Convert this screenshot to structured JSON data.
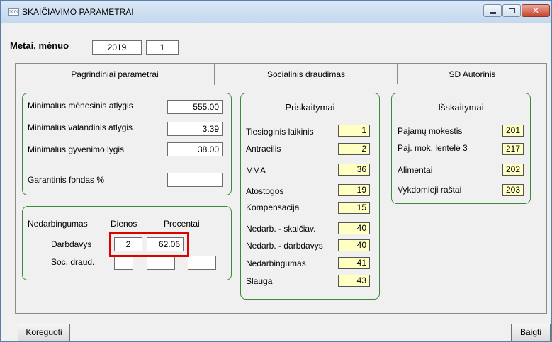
{
  "window": {
    "icon_text": "nono",
    "title": "SKAIČIAVIMO PARAMETRAI"
  },
  "header": {
    "label": "Metai, mėnuo",
    "year": "2019",
    "month": "1"
  },
  "tabs": [
    {
      "label": "Pagrindiniai parametrai",
      "active": true
    },
    {
      "label": "Socialinis draudimas",
      "active": false
    },
    {
      "label": "SD Autorinis",
      "active": false
    }
  ],
  "main_params": {
    "rows": [
      {
        "label": "Minimalus mėnesinis atlygis",
        "value": "555.00"
      },
      {
        "label": "Minimalus valandinis atlygis",
        "value": "3.39"
      },
      {
        "label": "Minimalus gyvenimo lygis",
        "value": "38.00"
      },
      {
        "label": "Garantinis fondas %",
        "value": ""
      }
    ]
  },
  "disability": {
    "title": "Nedarbingumas",
    "col_days": "Dienos",
    "col_percent": "Procentai",
    "rows": [
      {
        "label": "Darbdavys",
        "days": "2",
        "percent": "62.06",
        "extra": null
      },
      {
        "label": "Soc. draud.",
        "days": "",
        "percent": "",
        "extra": ""
      }
    ]
  },
  "accruals": {
    "title": "Priskaitymai",
    "rows": [
      {
        "label": "Tiesioginis laikinis",
        "code": "1"
      },
      {
        "label": "Antraeilis",
        "code": "2"
      },
      {
        "label": "MMA",
        "code": "36"
      },
      {
        "label": "Atostogos",
        "code": "19"
      },
      {
        "label": "Kompensacija",
        "code": "15"
      },
      {
        "label": "Nedarb. - skaičiav.",
        "code": "40"
      },
      {
        "label": "Nedarb. - darbdavys",
        "code": "40"
      },
      {
        "label": "Nedarbingumas",
        "code": "41"
      },
      {
        "label": "Slauga",
        "code": "43"
      }
    ]
  },
  "deductions": {
    "title": "Išskaitymai",
    "rows": [
      {
        "label": "Pajamų mokestis",
        "code": "201"
      },
      {
        "label": "Paj. mok. lentelė 3",
        "code": "217"
      },
      {
        "label": "Alimentai",
        "code": "202"
      },
      {
        "label": "Vykdomieji raštai",
        "code": "203"
      }
    ]
  },
  "footer": {
    "edit_button_label": "Koreguoti",
    "finish_button_label": "Baigti"
  },
  "colors": {
    "group_border": "#3a8a3a",
    "highlight": "#e00000",
    "code_field_bg": "#ffffc2"
  }
}
